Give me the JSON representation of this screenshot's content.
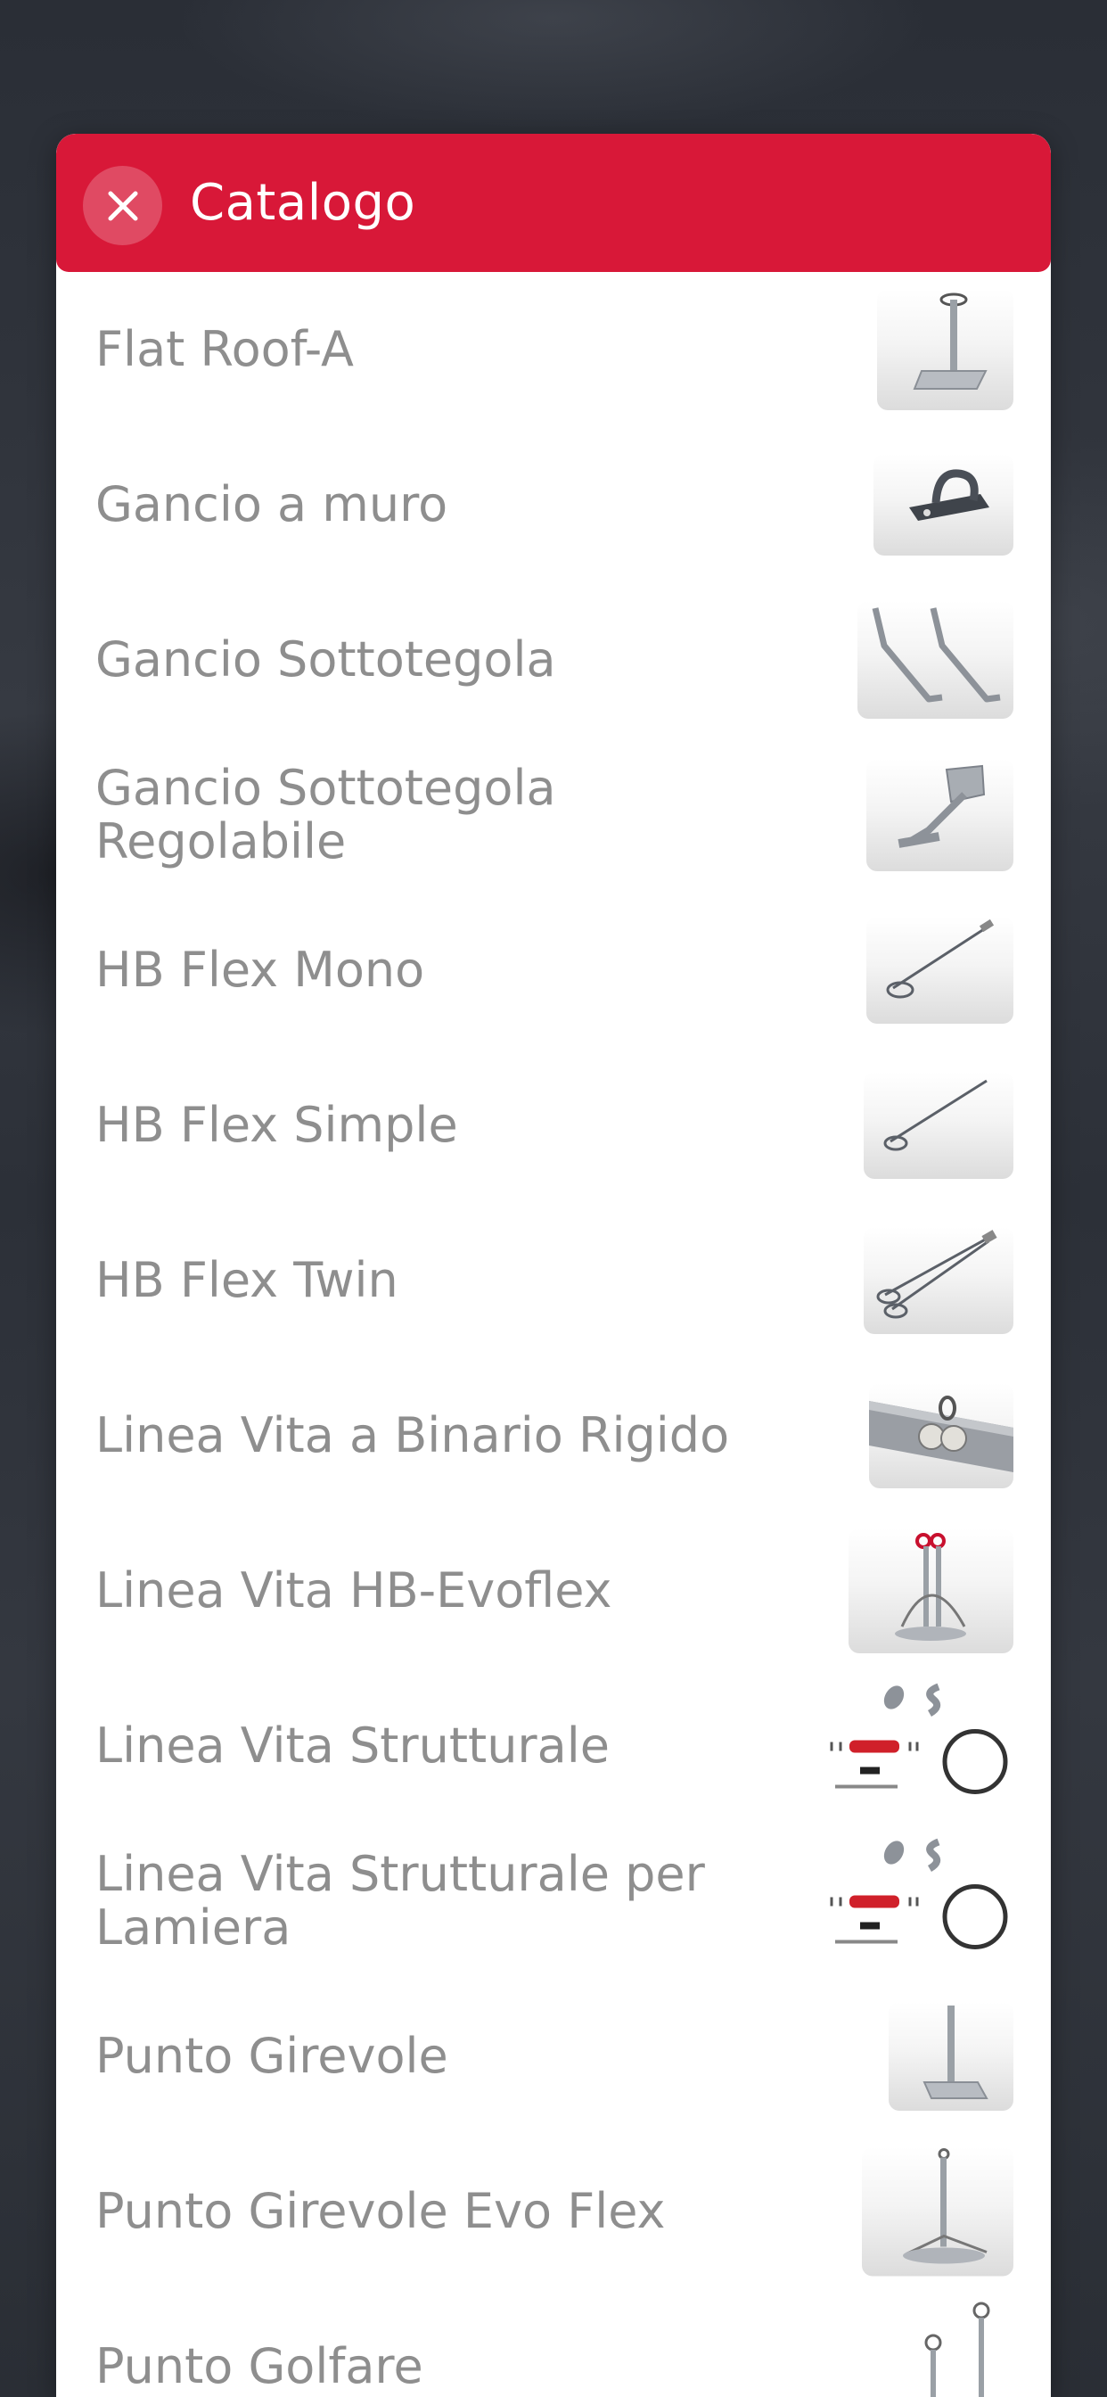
{
  "header": {
    "title": "Catalogo"
  },
  "icons": {
    "close": "close-icon"
  },
  "colors": {
    "header_bg": "#d81838",
    "item_text": "#8e8e8e"
  },
  "catalog": {
    "items": [
      {
        "label": "Flat Roof-A",
        "thumb": "flat-roof-anchor-image"
      },
      {
        "label": "Gancio a muro",
        "thumb": "wall-hook-image"
      },
      {
        "label": "Gancio Sottotegola",
        "thumb": "under-tile-hook-image"
      },
      {
        "label": "Gancio Sottotegola Regolabile",
        "thumb": "adjustable-under-tile-hook-image"
      },
      {
        "label": "HB Flex Mono",
        "thumb": "hb-flex-mono-image"
      },
      {
        "label": "HB Flex Simple",
        "thumb": "hb-flex-simple-image"
      },
      {
        "label": "HB Flex Twin",
        "thumb": "hb-flex-twin-image"
      },
      {
        "label": "Linea Vita a Binario Rigido",
        "thumb": "rigid-rail-lifeline-image"
      },
      {
        "label": "Linea Vita HB-Evoflex",
        "thumb": "hb-evoflex-lifeline-image"
      },
      {
        "label": "Linea Vita Strutturale",
        "thumb": "structural-lifeline-kit-image"
      },
      {
        "label": "Linea Vita Strutturale per Lamiera",
        "thumb": "structural-lifeline-sheet-kit-image"
      },
      {
        "label": "Punto Girevole",
        "thumb": "swivel-point-image"
      },
      {
        "label": "Punto Girevole Evo Flex",
        "thumb": "swivel-point-evo-flex-image"
      },
      {
        "label": "Punto Golfare",
        "thumb": "eyebolt-point-image"
      }
    ]
  }
}
